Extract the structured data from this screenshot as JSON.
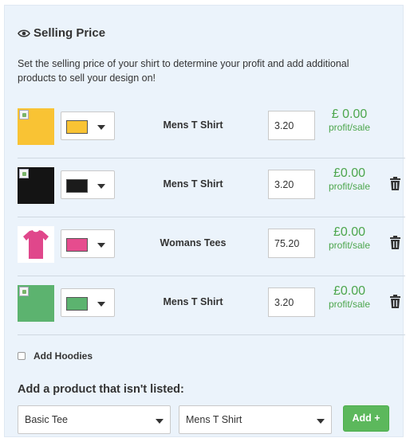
{
  "section": {
    "title": "Selling Price",
    "description": "Set the selling price of your shirt to determine your profit and add additional products to sell your design on!"
  },
  "products": [
    {
      "name": "Mens T Shirt",
      "color": "#f9c334",
      "thumb_color": "#f9c334",
      "thumb_type": "broken-image",
      "price": "3.20",
      "profit": "£ 0.00",
      "profit_label": "profit/sale",
      "deletable": false
    },
    {
      "name": "Mens T Shirt",
      "color": "#1b1b1b",
      "thumb_color": "#141414",
      "thumb_type": "broken-image",
      "price": "3.20",
      "profit": "£0.00",
      "profit_label": "profit/sale",
      "deletable": true
    },
    {
      "name": "Womans Tees",
      "color": "#e64c8e",
      "thumb_color": "#ffffff",
      "thumb_type": "pink-tee",
      "price": "75.20",
      "profit": "£0.00",
      "profit_label": "profit/sale",
      "deletable": true
    },
    {
      "name": "Mens T Shirt",
      "color": "#5cb36f",
      "thumb_color": "#5cb36f",
      "thumb_type": "broken-image",
      "price": "3.20",
      "profit": "£0.00",
      "profit_label": "profit/sale",
      "deletable": true
    }
  ],
  "add_hoodies": {
    "label": "Add Hoodies",
    "checked": false
  },
  "add_product": {
    "title": "Add a product that isn't listed:",
    "type_select": "Basic Tee",
    "product_select": "Mens T Shirt",
    "button_label": "Add +"
  },
  "colors": {
    "accent_green": "#5cb85c",
    "profit_green": "#4ca64c",
    "panel_bg": "#ebf3fb"
  }
}
